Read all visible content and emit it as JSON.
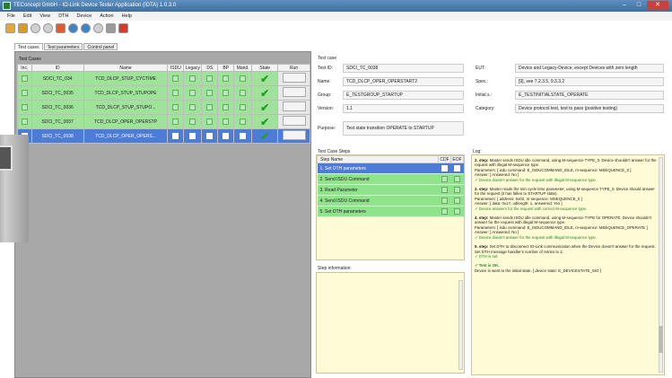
{
  "window": {
    "title": "TEConcept GmbH - IO-Link Device Tester Application (IDTA) 1.0.3.0",
    "buttons": [
      "–",
      "□",
      "✕"
    ]
  },
  "menu": [
    "File",
    "Edit",
    "View",
    "DTH",
    "Device",
    "Action",
    "Help"
  ],
  "toolbar": {
    "icons": [
      "folder-open-icon",
      "save-icon",
      "record-icon",
      "stop-icon",
      "document-icon",
      "refresh-icon",
      "cycle-icon",
      "sync-icon",
      "pause-icon",
      "cancel-icon"
    ],
    "colors": [
      "#e8a838",
      "#d99b2b",
      "#d0d0d0",
      "#d0d0d0",
      "#e25b2b",
      "#3c86c8",
      "#3c86c8",
      "#d0d0d0",
      "#9a9a9a",
      "#d63a2a"
    ]
  },
  "tabs": [
    "Test cases",
    "Test parameters",
    "Control panel"
  ],
  "test_cases": {
    "group_label": "Test Cases",
    "columns": [
      "Inc.",
      "ID",
      "Name",
      "ISDU",
      "Legacy",
      "DS",
      "BP",
      "Mand.",
      "State",
      "Run"
    ],
    "rows": [
      {
        "id": "SDCI_TC_034",
        "name": "TCD_DLCP_STUP_CYCTIME"
      },
      {
        "id": "SDCI_TC_0035",
        "name": "TCD_DLCP_STUP_STUPOPE"
      },
      {
        "id": "SDCI_TC_0036",
        "name": "TCD_DLCP_STUP_STUPO..."
      },
      {
        "id": "SDCI_TC_0037",
        "name": "TCD_DLCP_OPER_OPERSTP"
      },
      {
        "id": "SDCI_TC_0038",
        "name": "TCD_DLCP_OPER_OPERS..."
      }
    ]
  },
  "test_case": {
    "group_label": "Test case",
    "labels": {
      "id": "Test ID:",
      "name": "Name:",
      "group": "Group:",
      "version": "Version:",
      "purpose": "Purpose:",
      "eut": "EUT:",
      "spec": "Spec.:",
      "initial": "Initial s.:",
      "category": "Category:"
    },
    "id": "SDCI_TC_0038",
    "name": "TCD_DLCP_OPER_OPERSTART2",
    "group": "E_TESTGROUP_STARTUP",
    "version": "1.1",
    "purpose": "Test state transition OPERATE to STARTUP",
    "eut": "Device and Legacy-Device, except Devices with zero length",
    "spec": "[9], see 7.2.3.5, 9.3.3.2",
    "initial": "E_TESTINITIALSTATE_OPERATE",
    "category": "Device protocol test, test to pass (positive testing)"
  },
  "test_case_steps": {
    "group_label": "Test Case Steps",
    "columns": [
      "Step Name",
      "CDF",
      "EOF"
    ],
    "rows": [
      "1. Set DTH parameters",
      "2. Send ISDU Command",
      "3. Read Parameter",
      "4. Send ISDU Command",
      "5. Set DTH parameters"
    ]
  },
  "step_information": {
    "label": "Step information:"
  },
  "log": {
    "label": "Log:",
    "entries": [
      {
        "head": "2. step:",
        "text": "Master sends ISDU idle command, using M-sequence TYPE_0. Device shouldn't answer for the request with illegal M-sequence type.",
        "detail": "Parameters: [ isdu command: E_ISDUCOMMAND_IDLE, m-sequence: MSEQUENCE_0 ]",
        "answer": "Answer: [ Answered: No ]",
        "ok": "✓ Device doesn't answer for the request with illegal M-sequence type."
      },
      {
        "head": "3. step:",
        "text": "Master reads the min cycle time parameter, using M-sequence TYPE_0. Device should answer for the request (it has fallen to STARTUP state).",
        "detail": "Parameters: [ address: 0x02, m-sequence: MSEQUENCE_0 ]",
        "answer": "Answer: [ data: 0x17, odlength: 1, answered: Yes ]",
        "ok": "✓ Device answers for the request with correct M-sequence type."
      },
      {
        "head": "4. step:",
        "text": "Master sends ISDU idle command, using M-sequence TYPE for OPERATE. Device shouldn't answer for the request with illegal M-sequence type.",
        "detail": "Parameters: [ isdu command: E_ISDUCOMMAND_IDLE, m-sequence: MSEQUENCE_OPERATE ]",
        "answer": "Answer: [ Answered: No ]",
        "ok": "✓ Device doesn't answer for the request with illegal M-sequence type."
      },
      {
        "head": "5. step:",
        "text": "Set DTH to disconnect IO-Link communication when the Device doesn't answer for the request. Set DTH message handler's number of retries to 2.",
        "detail": "",
        "answer": "",
        "ok": "✓ DTH is set."
      }
    ],
    "result": "✓ Test is OK.",
    "final": "Device is went to the initial state. [ device state: E_DEVICESTATE_SIO ]"
  },
  "colors": {
    "row_green": "#9fe39b",
    "row_selected": "#4d7bd8",
    "panel_yellow": "#fffbd6",
    "title_blue": "#4f7fb0",
    "close_red": "#c8413a"
  }
}
